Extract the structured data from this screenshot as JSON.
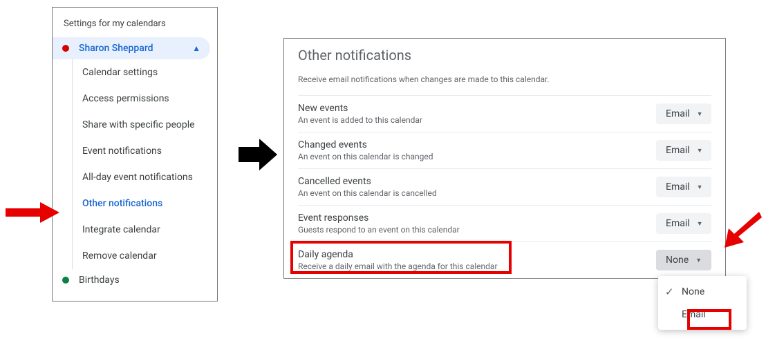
{
  "sidebar": {
    "heading": "Settings for my calendars",
    "calendars": [
      {
        "name": "Sharon Sheppard",
        "color": "#d50000",
        "expanded": true
      },
      {
        "name": "Birthdays",
        "color": "#0b8043",
        "expanded": false
      }
    ],
    "items": [
      {
        "label": "Calendar settings"
      },
      {
        "label": "Access permissions"
      },
      {
        "label": "Share with specific people"
      },
      {
        "label": "Event notifications"
      },
      {
        "label": "All-day event notifications"
      },
      {
        "label": "Other notifications"
      },
      {
        "label": "Integrate calendar"
      },
      {
        "label": "Remove calendar"
      }
    ]
  },
  "main": {
    "title": "Other notifications",
    "description": "Receive email notifications when changes are made to this calendar.",
    "rows": [
      {
        "title": "New events",
        "sub": "An event is added to this calendar",
        "value": "Email"
      },
      {
        "title": "Changed events",
        "sub": "An event on this calendar is changed",
        "value": "Email"
      },
      {
        "title": "Cancelled events",
        "sub": "An event on this calendar is cancelled",
        "value": "Email"
      },
      {
        "title": "Event responses",
        "sub": "Guests respond to an event on this calendar",
        "value": "Email"
      },
      {
        "title": "Daily agenda",
        "sub": "Receive a daily email with the agenda for this calendar",
        "value": "None"
      }
    ]
  },
  "dropdown": {
    "options": [
      {
        "label": "None",
        "selected": true
      },
      {
        "label": "Email",
        "selected": false
      }
    ]
  }
}
